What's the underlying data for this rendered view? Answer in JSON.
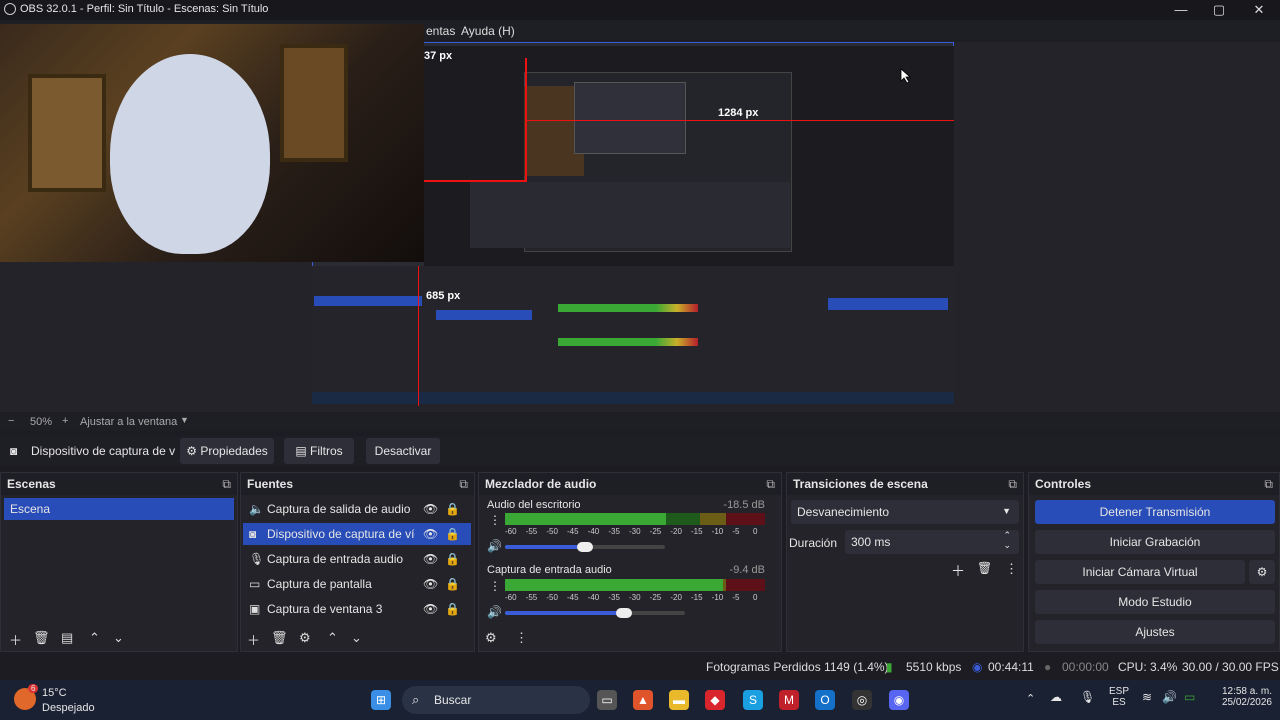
{
  "window": {
    "title": "OBS 32.0.1 - Perfil: Sin Título - Escenas: Sin Título"
  },
  "menu": {
    "visible_items": [
      "entas",
      "Ayuda (H)"
    ]
  },
  "preview": {
    "measure_labels": [
      "37 px",
      "1284 px",
      "685 px"
    ],
    "zoom": "50%",
    "fit_label": "Ajustar a la ventana",
    "zoom_minus": "−",
    "zoom_plus": "+"
  },
  "context": {
    "source_name": "Dispositivo de captura de v",
    "properties": "Propiedades",
    "filters": "Filtros",
    "deactivate": "Desactivar"
  },
  "scenes": {
    "title": "Escenas",
    "items": [
      {
        "label": "Escena",
        "selected": true
      }
    ]
  },
  "sources": {
    "title": "Fuentes",
    "items": [
      {
        "icon": "speaker-icon",
        "label": "Captura de salida de audio"
      },
      {
        "icon": "camera-icon",
        "label": "Dispositivo de captura de vídeo",
        "selected": true
      },
      {
        "icon": "microphone-icon",
        "label": "Captura de entrada audio"
      },
      {
        "icon": "monitor-icon",
        "label": "Captura de pantalla"
      },
      {
        "icon": "window-icon",
        "label": "Captura de ventana 3"
      }
    ]
  },
  "mixer": {
    "title": "Mezclador de audio",
    "channels": [
      {
        "name": "Audio del escritorio",
        "db": "-18.5 dB",
        "level": 0.62,
        "volume": 0.5
      },
      {
        "name": "Captura de entrada audio",
        "db": "-9.4 dB",
        "level": 0.84,
        "volume": 0.66
      }
    ],
    "ticks": [
      "-60",
      "-55",
      "-50",
      "-45",
      "-40",
      "-35",
      "-30",
      "-25",
      "-20",
      "-15",
      "-10",
      "-5",
      "0"
    ]
  },
  "transitions": {
    "title": "Transiciones de escena",
    "selected": "Desvanecimiento",
    "duration_label": "Duración",
    "duration_value": "300 ms"
  },
  "controls": {
    "title": "Controles",
    "buttons": [
      "Detener Transmisión",
      "Iniciar Grabación",
      "Iniciar Cámara Virtual",
      "Modo Estudio",
      "Ajustes"
    ]
  },
  "status": {
    "dropped": "Fotogramas Perdidos 1149 (1.4%)",
    "bitrate": "5510 kbps",
    "stream_time": "00:44:11",
    "rec_time": "00:00:00",
    "cpu": "CPU: 3.4%",
    "fps": "30.00 / 30.00 FPS"
  },
  "taskbar": {
    "weather_temp": "15°C",
    "weather_desc": "Despejado",
    "search": "Buscar",
    "lang_top": "ESP",
    "lang_bottom": "ES",
    "time": "12:58 a. m.",
    "date": "25/02/2026",
    "badge": "6"
  },
  "colors": {
    "accent": "#284cb8",
    "meter_green": "#3aa835",
    "meter_yellow": "#c8b02a",
    "meter_red": "#b51e2a"
  }
}
